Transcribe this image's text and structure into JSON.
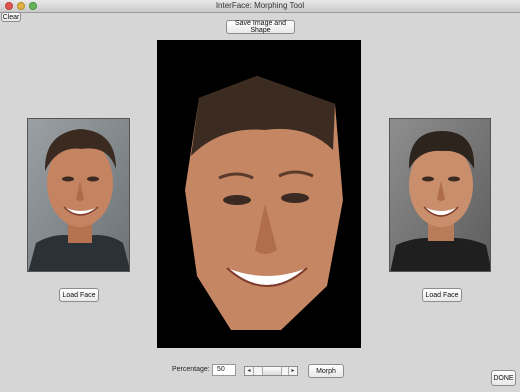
{
  "window": {
    "title": "InterFace: Morphing Tool"
  },
  "toolbar": {
    "clear_label": "Clear",
    "save_label": "Save Image and Shape"
  },
  "left_panel": {
    "load_label": "Load Face",
    "image": "face-photo-left"
  },
  "right_panel": {
    "load_label": "Load Face",
    "image": "face-photo-right"
  },
  "center": {
    "image": "morphed-face"
  },
  "controls": {
    "percentage_label": "Percentage:",
    "percentage_value": "50",
    "slider_fraction": 0.5,
    "morph_label": "Morph",
    "done_label": "DONE"
  },
  "colors": {
    "background": "#d6d6d6",
    "canvas": "#000000"
  }
}
